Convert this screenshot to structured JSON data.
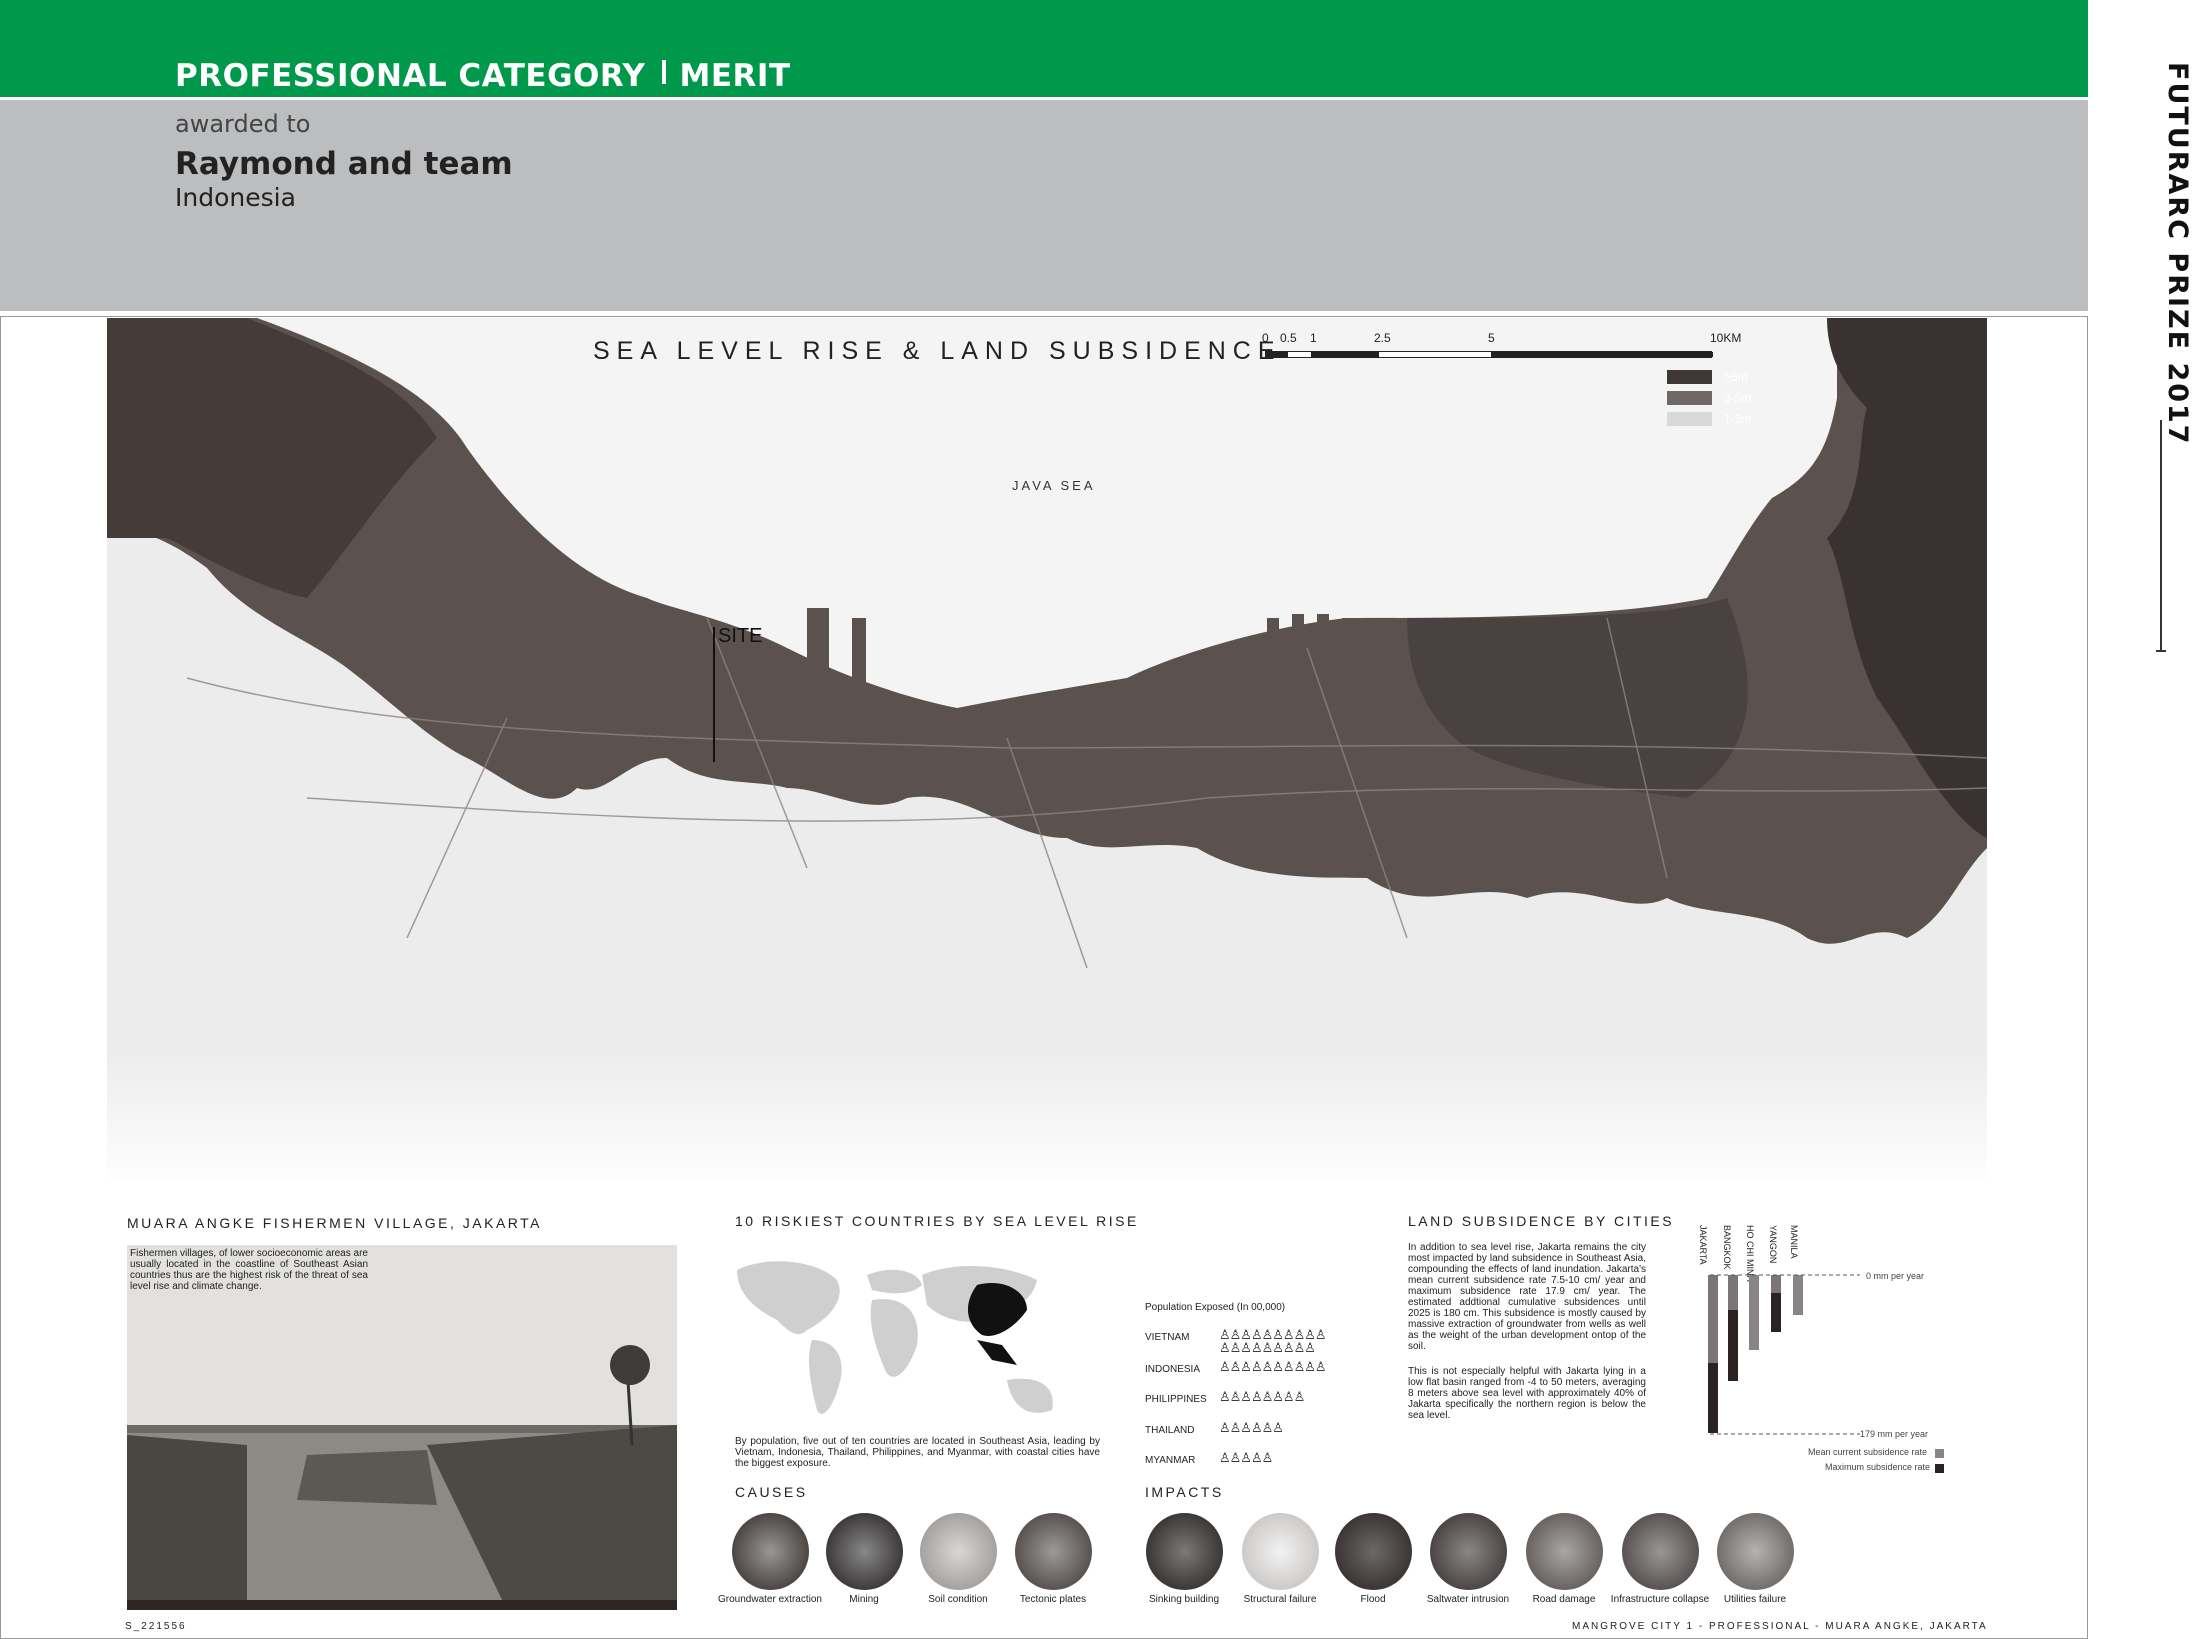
{
  "header": {
    "category": "PROFESSIONAL CATEGORY",
    "award": "MERIT",
    "awarded_to": "awarded to",
    "winner": "Raymond and team",
    "country": "Indonesia",
    "side_title": "FUTURARC PRIZE 2017"
  },
  "map": {
    "title": "SEA LEVEL RISE  &  LAND SUBSIDENCE",
    "scale_ticks": [
      "0",
      "0.5",
      "1",
      "2.5",
      "5",
      "10KM"
    ],
    "legend": [
      {
        "label": ">5m",
        "color": "#3f3735"
      },
      {
        "label": "3-5m",
        "color": "#6e6866"
      },
      {
        "label": "1-3m",
        "color": "#d9d9d9"
      }
    ],
    "sea_label": "JAVA SEA",
    "site_label": "SITE"
  },
  "village": {
    "heading": "MUARA ANGKE FISHERMEN VILLAGE, JAKARTA",
    "caption": "Fishermen villages, of lower socioeconomic areas are usually located in the coastline of Southeast Asian countries thus are the highest risk of the threat of sea level rise and climate change."
  },
  "riskiest": {
    "heading": "10 RISKIEST COUNTRIES BY SEA LEVEL RISE",
    "note": "By population, five out of ten countries are located in Southeast Asia, leading by Vietnam, Indonesia, Thailand, Philippines, and Myanmar, with coastal cities have the biggest exposure.",
    "population_title": "Population Exposed (In 00,000)",
    "countries": [
      {
        "name": "VIETNAM",
        "count": 19
      },
      {
        "name": "INDONESIA",
        "count": 10
      },
      {
        "name": "PHILIPPINES",
        "count": 8
      },
      {
        "name": "THAILAND",
        "count": 6
      },
      {
        "name": "MYANMAR",
        "count": 5
      }
    ]
  },
  "causes": {
    "heading": "CAUSES",
    "items": [
      "Groundwater extraction",
      "Mining",
      "Soil condition",
      "Tectonic plates"
    ]
  },
  "impacts": {
    "heading": "IMPACTS",
    "items": [
      "Sinking building",
      "Structural failure",
      "Flood",
      "Saltwater intrusion",
      "Road damage",
      "Infrastructure collapse",
      "Utilities failure"
    ]
  },
  "subsidence": {
    "heading": "LAND SUBSIDENCE BY CITIES",
    "para1": "In addition to sea level rise, Jakarta remains the city most impacted by land subsidence in Southeast Asia, compounding the effects of land inundation. Jakarta's mean current subsidence rate 7.5-10 cm/ year and maximum subsidence rate 17.9 cm/ year. The estimated addtional cumulative subsidences until 2025 is 180 cm. This subsidence is mostly caused by massive extraction of groundwater from wells as well as the weight of the urban development ontop of the soil.",
    "para2": "This is not especially helpful with Jakarta lying in a low flat basin ranged from -4 to 50 meters, averaging 8 meters above sea level with approximately 40% of Jakarta specifically the northern region is below the sea level.",
    "chart": {
      "cities": [
        "JAKARTA",
        "BANGKOK",
        "HO CHI MINH",
        "YANGON",
        "MANILA"
      ],
      "axis_top": "0 mm per year",
      "axis_bottom": "179 mm per year",
      "legend_mean": "Mean current subsidence rate",
      "legend_max": "Maximum subsidence rate",
      "color_mean": "#8a8584",
      "color_max": "#2a2322",
      "max_scale": 179,
      "mean_mm": [
        100,
        40,
        85,
        20,
        45
      ],
      "max_mm": [
        179,
        120,
        0,
        65,
        0
      ]
    }
  },
  "footer": {
    "left": "S_221556",
    "right": "MANGROVE CITY 1 - PROFESSIONAL - MUARA ANGKE, JAKARTA"
  }
}
